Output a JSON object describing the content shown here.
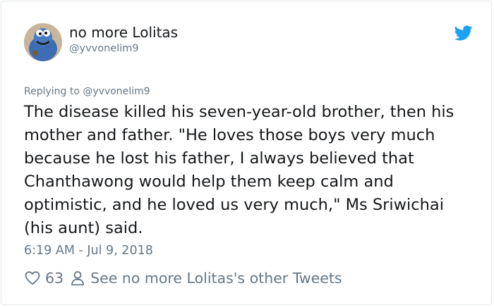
{
  "author": {
    "name": "no more Lolitas",
    "handle": "@yvvonelim9"
  },
  "tweet": {
    "replying_label": "Replying to",
    "replying_handle": "@yvvonelim9",
    "text": "The disease killed his seven-year-old brother, then his mother and father. \"He loves those boys very much because he lost his father, I always believed that Chanthawong would help them keep calm and optimistic, and he loved us very much,\" Ms Sriwichai (his aunt) said.",
    "timestamp": "6:19 AM - Jul 9, 2018"
  },
  "actions": {
    "like_count": "63",
    "see_more_label": "See no more Lolitas's other Tweets"
  },
  "colors": {
    "brand": "#1da1f2",
    "text": "#14171a",
    "muted": "#657786"
  },
  "icons": {
    "logo": "twitter-bird-icon",
    "like": "heart-icon",
    "profile": "person-icon"
  }
}
